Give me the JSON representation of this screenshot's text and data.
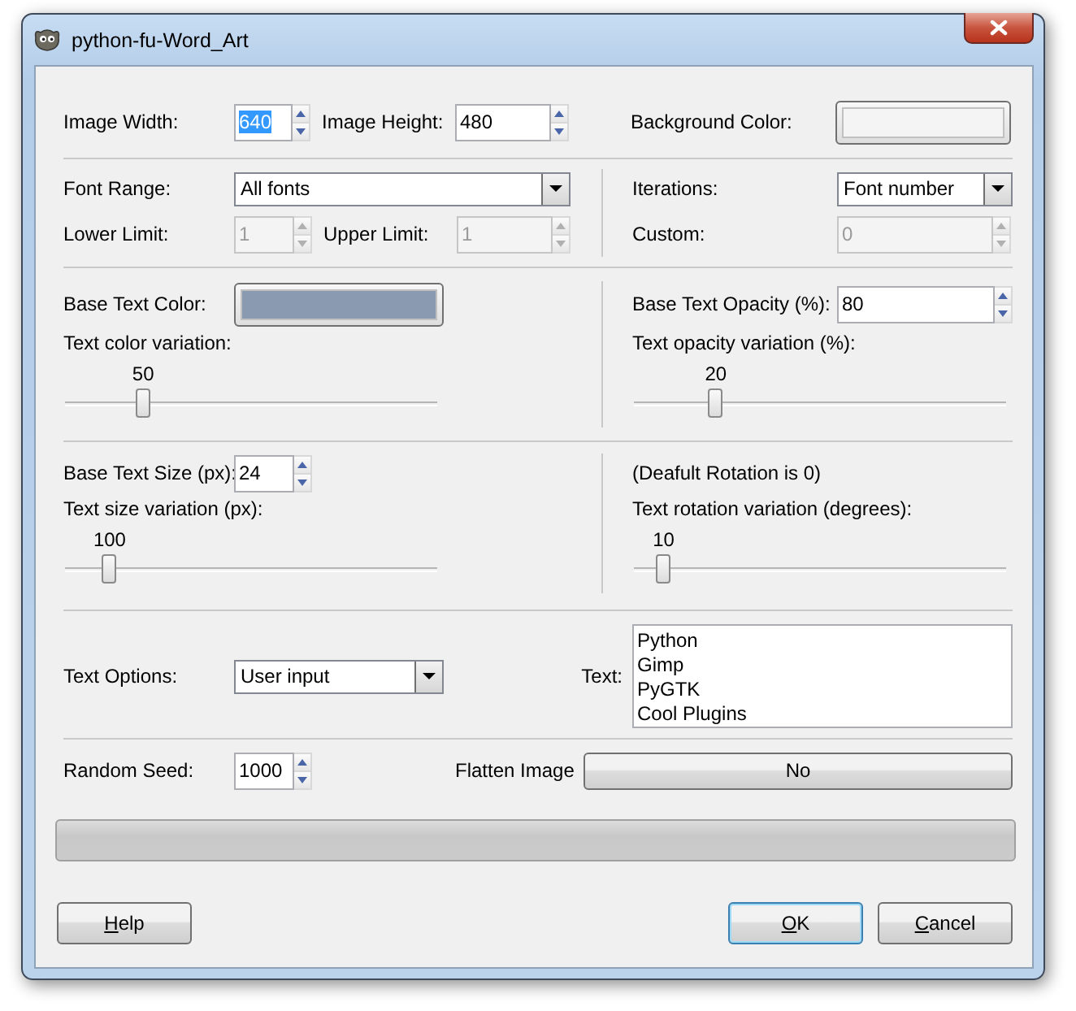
{
  "window": {
    "title": "python-fu-Word_Art"
  },
  "image_size": {
    "width": {
      "label": "Image Width:",
      "value": "640",
      "text_selected": true,
      "disabled": false
    },
    "height": {
      "label": "Image Height:",
      "value": "480",
      "text_selected": false,
      "disabled": false
    }
  },
  "background_color": {
    "label": "Background Color:",
    "color": "#f4f4f4"
  },
  "font_range": {
    "label": "Font Range:",
    "value": "All fonts"
  },
  "lower_limit": {
    "label": "Lower Limit:",
    "value": "1",
    "text_selected": false,
    "disabled": true
  },
  "upper_limit": {
    "label": "Upper Limit:",
    "value": "1",
    "text_selected": false,
    "disabled": true
  },
  "iterations": {
    "label": "Iterations:",
    "value": "Font number"
  },
  "custom": {
    "label": "Custom:",
    "value": "0",
    "text_selected": false,
    "disabled": true
  },
  "base_text_color": {
    "label": "Base Text Color:",
    "color": "#8a9ab0"
  },
  "color_variation": {
    "label": "Text color variation:",
    "reading": "50",
    "level": 0.21
  },
  "base_opacity": {
    "label": "Base Text Opacity (%):",
    "value": "80",
    "text_selected": false,
    "disabled": false
  },
  "opacity_variation": {
    "label": "Text opacity variation (%):",
    "reading": "20",
    "level": 0.22
  },
  "base_size": {
    "label": "Base Text Size (px):",
    "value": "24",
    "text_selected": false,
    "disabled": false
  },
  "size_variation": {
    "label": "Text size variation (px):",
    "reading": "100",
    "level": 0.12
  },
  "rotation_note": "(Deafult Rotation is 0)",
  "rotation_variation": {
    "label": "Text rotation variation (degrees):",
    "reading": "10",
    "level": 0.08
  },
  "text_options": {
    "label": "Text Options:",
    "value": "User input"
  },
  "text": {
    "label": "Text:",
    "lines": [
      "Python",
      "Gimp",
      "PyGTK",
      "Cool Plugins"
    ]
  },
  "random_seed": {
    "label": "Random Seed:",
    "value": "1000",
    "text_selected": false,
    "disabled": false
  },
  "flatten_image": {
    "label": "Flatten Image",
    "value": "No"
  },
  "progress": {
    "level": 0
  },
  "buttons": [
    {
      "mnemonic": "H",
      "label_after": "elp",
      "focused": false
    },
    {
      "mnemonic": "O",
      "label_after": "K",
      "focused": true
    },
    {
      "mnemonic": "C",
      "label_after": "ancel",
      "focused": false
    }
  ]
}
